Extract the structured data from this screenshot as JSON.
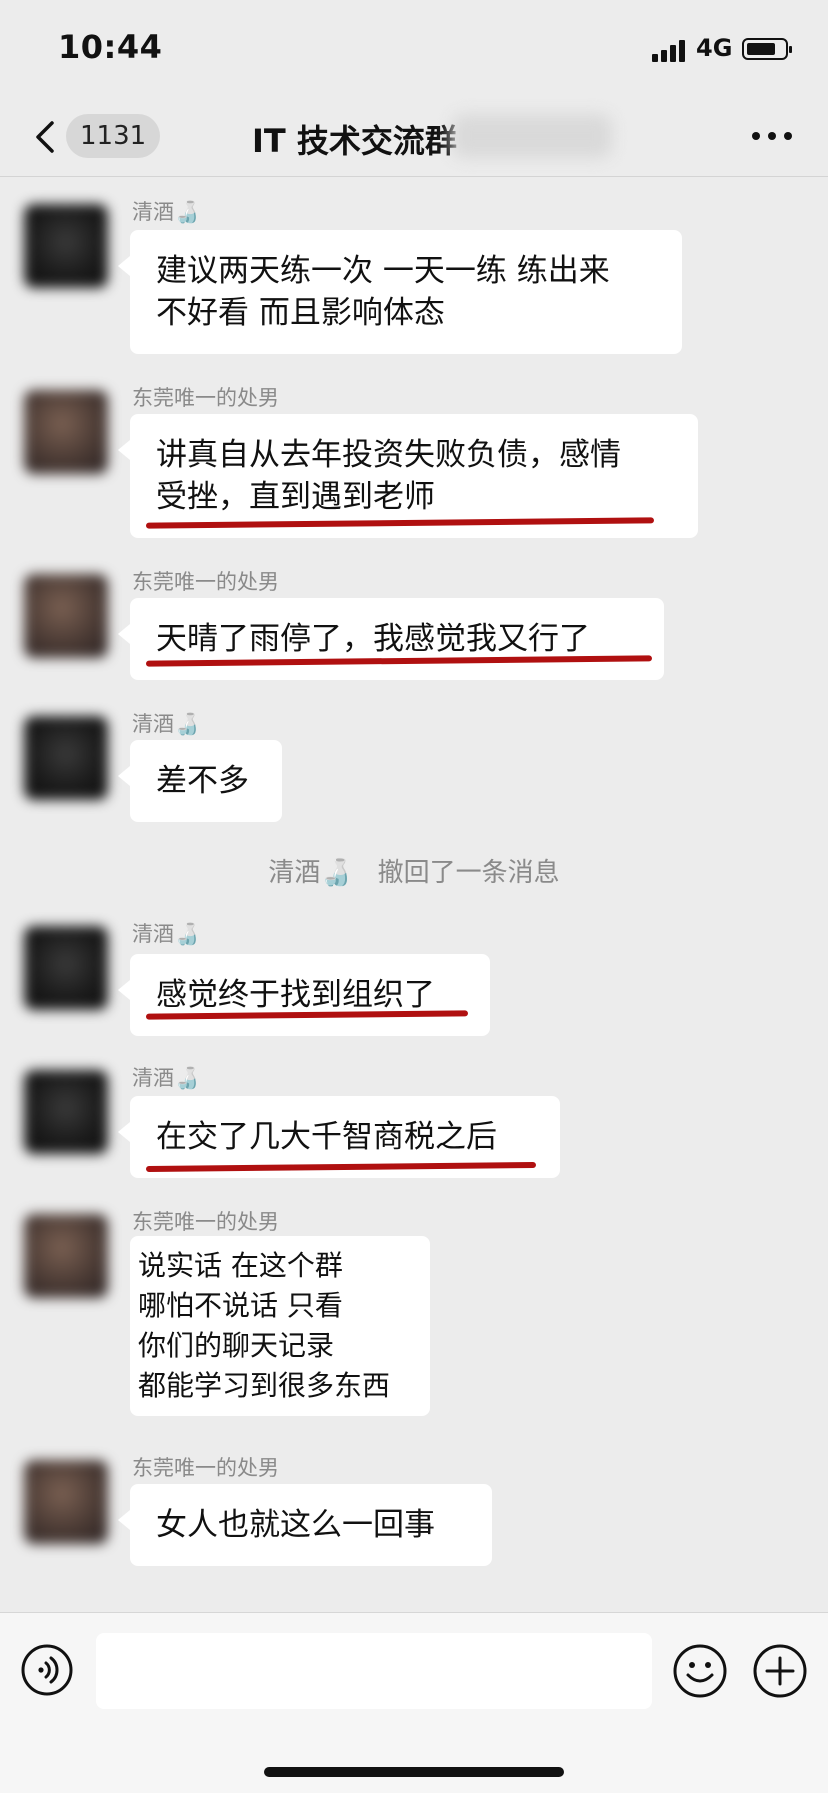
{
  "status_bar": {
    "time": "10:44",
    "network": "4G"
  },
  "nav": {
    "unread_count": "1131",
    "title": "IT 技术交流群"
  },
  "messages": [
    {
      "sender": "清酒🍶",
      "lines": [
        "建议两天练一次 一天一练 练出来",
        "不好看 而且影响体态"
      ]
    },
    {
      "sender": "东莞唯一的处男",
      "lines": [
        "讲真自从去年投资失败负债，感情",
        "受挫，直到遇到老师"
      ]
    },
    {
      "sender": "东莞唯一的处男",
      "lines": [
        "天晴了雨停了，我感觉我又行了"
      ]
    },
    {
      "sender": "清酒🍶",
      "lines": [
        "差不多"
      ]
    },
    {
      "sender": "清酒🍶",
      "lines": [
        "感觉终于找到组织了"
      ]
    },
    {
      "sender": "清酒🍶",
      "lines": [
        "在交了几大千智商税之后"
      ]
    },
    {
      "sender": "东莞唯一的处男",
      "lines": [
        "说实话  在这个群",
        "哪怕不说话  只看",
        "你们的聊天记录",
        "都能学习到很多东西"
      ]
    },
    {
      "sender": "东莞唯一的处男",
      "lines": [
        "女人也就这么一回事"
      ]
    }
  ],
  "recall_notice": {
    "name": "清酒🍶",
    "text": "撤回了一条消息"
  },
  "input": {
    "placeholder": ""
  },
  "icons": {
    "back": "chevron-left-icon",
    "more": "more-dots-icon",
    "voice": "voice-icon",
    "emoji": "emoji-icon",
    "plus": "plus-icon"
  },
  "colors": {
    "annotation_underline": "#b01010",
    "background": "#ececec",
    "bubble": "#ffffff"
  }
}
